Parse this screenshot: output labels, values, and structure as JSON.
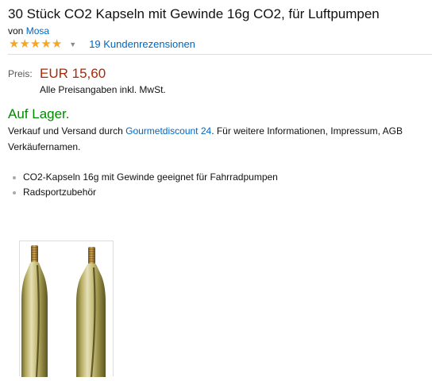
{
  "product": {
    "title": "30 Stück CO2 Kapseln mit Gewinde 16g CO2, für Luftpumpen",
    "by_prefix": "von",
    "brand": "Mosa",
    "rating_stars": 5,
    "reviews_label": "19 Kundenrezensionen"
  },
  "price": {
    "label": "Preis:",
    "value": "EUR 15,60",
    "note": "Alle Preisangaben inkl. MwSt."
  },
  "availability": {
    "stock": "Auf Lager.",
    "seller_prefix": "Verkauf und Versand durch",
    "seller_name": "Gourmetdiscount 24",
    "seller_suffix": ". Für weitere Informationen, Impressum, AGB",
    "seller_line2": "Verkäufernamen."
  },
  "features": [
    "CO2-Kapseln 16g mit Gewinde geeignet für Fahrradpumpen",
    "Radsportzubehör"
  ],
  "colors": {
    "price": "#b12704",
    "stock": "#008a00",
    "link": "#0066c0",
    "star": "#f5a623"
  }
}
